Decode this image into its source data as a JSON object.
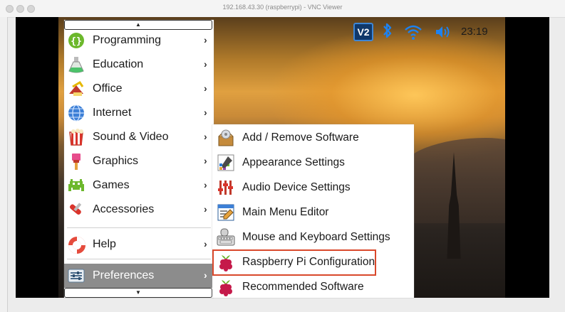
{
  "window": {
    "title": "192.168.43.30 (raspberrypi) - VNC Viewer"
  },
  "tray": {
    "vnc_label": "V2",
    "bluetooth_glyph": "✱",
    "clock": "23:19"
  },
  "menu": {
    "scroll_up": "▲",
    "scroll_down": "▼",
    "submenu_arrow": "›",
    "items": [
      {
        "label": "Programming",
        "icon": "programming-icon"
      },
      {
        "label": "Education",
        "icon": "education-icon"
      },
      {
        "label": "Office",
        "icon": "office-icon"
      },
      {
        "label": "Internet",
        "icon": "internet-icon"
      },
      {
        "label": "Sound & Video",
        "icon": "sound-video-icon"
      },
      {
        "label": "Graphics",
        "icon": "graphics-icon"
      },
      {
        "label": "Games",
        "icon": "games-icon"
      },
      {
        "label": "Accessories",
        "icon": "accessories-icon"
      },
      {
        "label": "Help",
        "icon": "help-icon"
      },
      {
        "label": "Preferences",
        "icon": "preferences-icon"
      }
    ]
  },
  "submenu": {
    "items": [
      {
        "label": "Add / Remove Software",
        "icon": "package-icon"
      },
      {
        "label": "Appearance Settings",
        "icon": "appearance-icon"
      },
      {
        "label": "Audio Device Settings",
        "icon": "audio-sliders-icon"
      },
      {
        "label": "Main Menu Editor",
        "icon": "menu-editor-icon"
      },
      {
        "label": "Mouse and Keyboard Settings",
        "icon": "keyboard-mouse-icon"
      },
      {
        "label": "Raspberry Pi Configuration",
        "icon": "raspberry-icon"
      },
      {
        "label": "Recommended Software",
        "icon": "raspberry-icon"
      }
    ]
  },
  "colors": {
    "highlight_border": "#d9482b",
    "selected_bg": "#8c8c8c",
    "bluetooth": "#1d82f0",
    "raspberry": "#c51a4a"
  }
}
